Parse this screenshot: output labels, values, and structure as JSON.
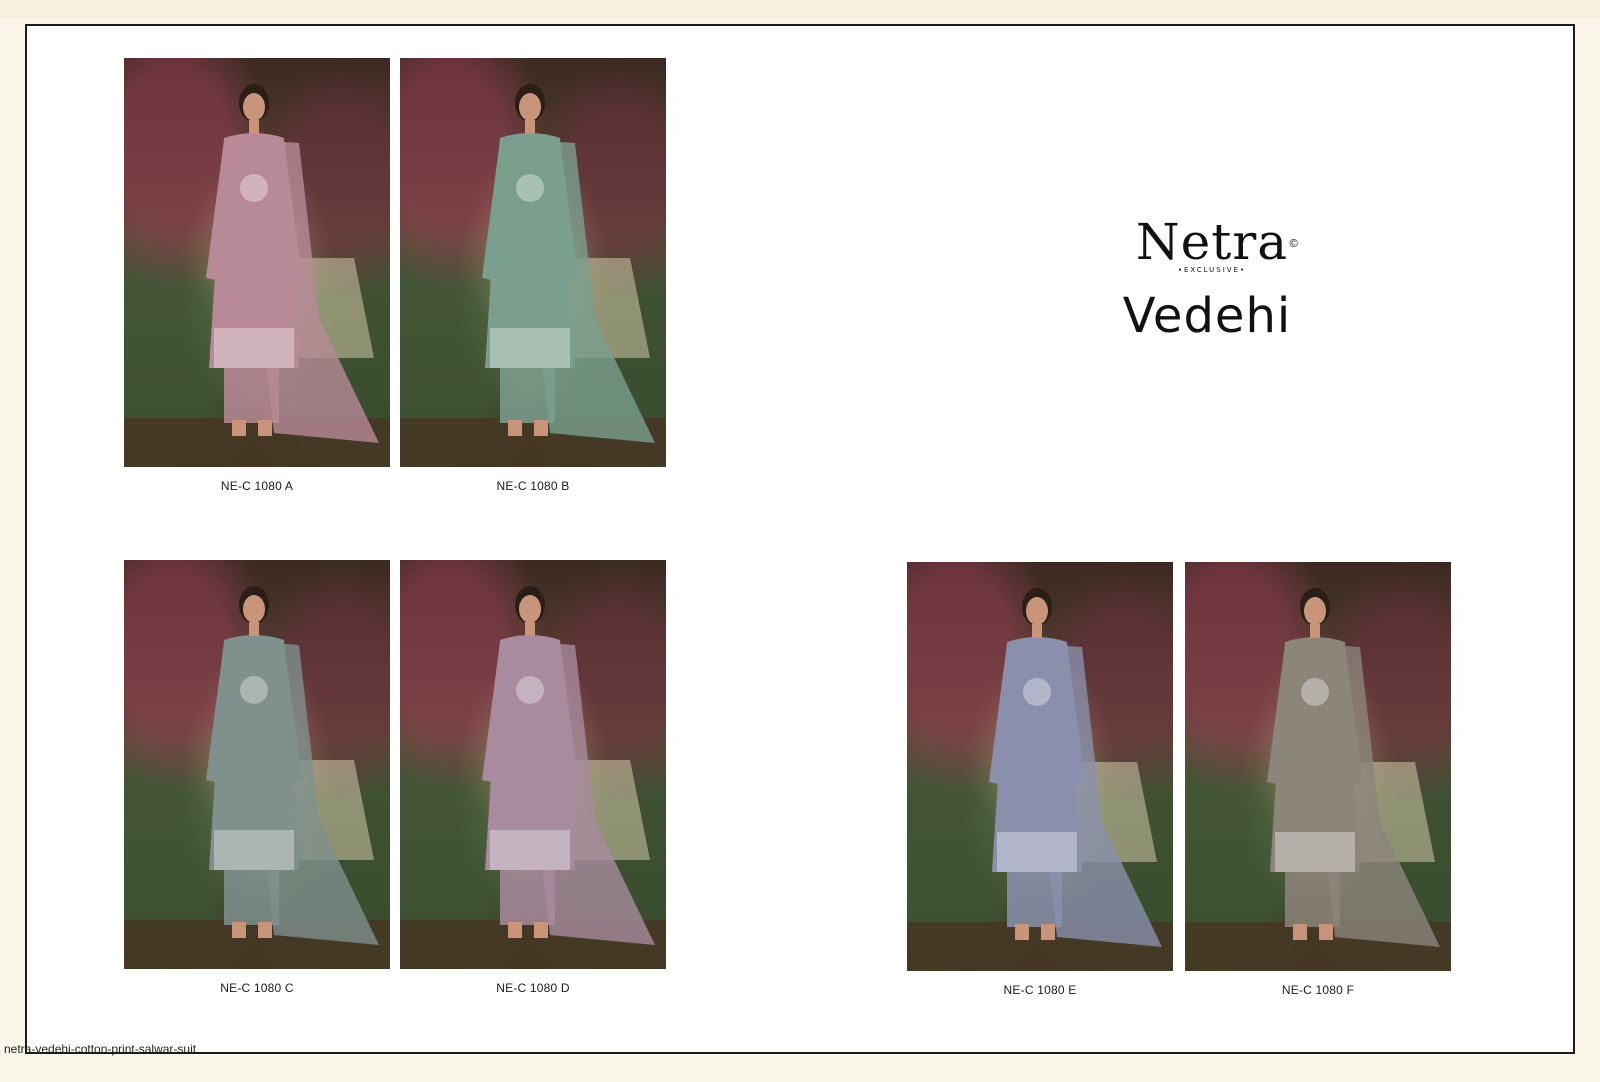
{
  "brand": {
    "name": "Netra",
    "mark": "©",
    "tagline": "•EXCLUSIVE•"
  },
  "collection_title": "Vedehi",
  "products": [
    {
      "code": "NE-C 1080 A",
      "color": "#b88a97"
    },
    {
      "code": "NE-C 1080 B",
      "color": "#7b9f8e"
    },
    {
      "code": "NE-C 1080 C",
      "color": "#7f908d"
    },
    {
      "code": "NE-C 1080 D",
      "color": "#a88b9e"
    },
    {
      "code": "NE-C 1080 E",
      "color": "#8a90ab"
    },
    {
      "code": "NE-C 1080 F",
      "color": "#8c857a"
    }
  ],
  "footer_url": "netra-vedehi-cotton-print-salwar-suit"
}
